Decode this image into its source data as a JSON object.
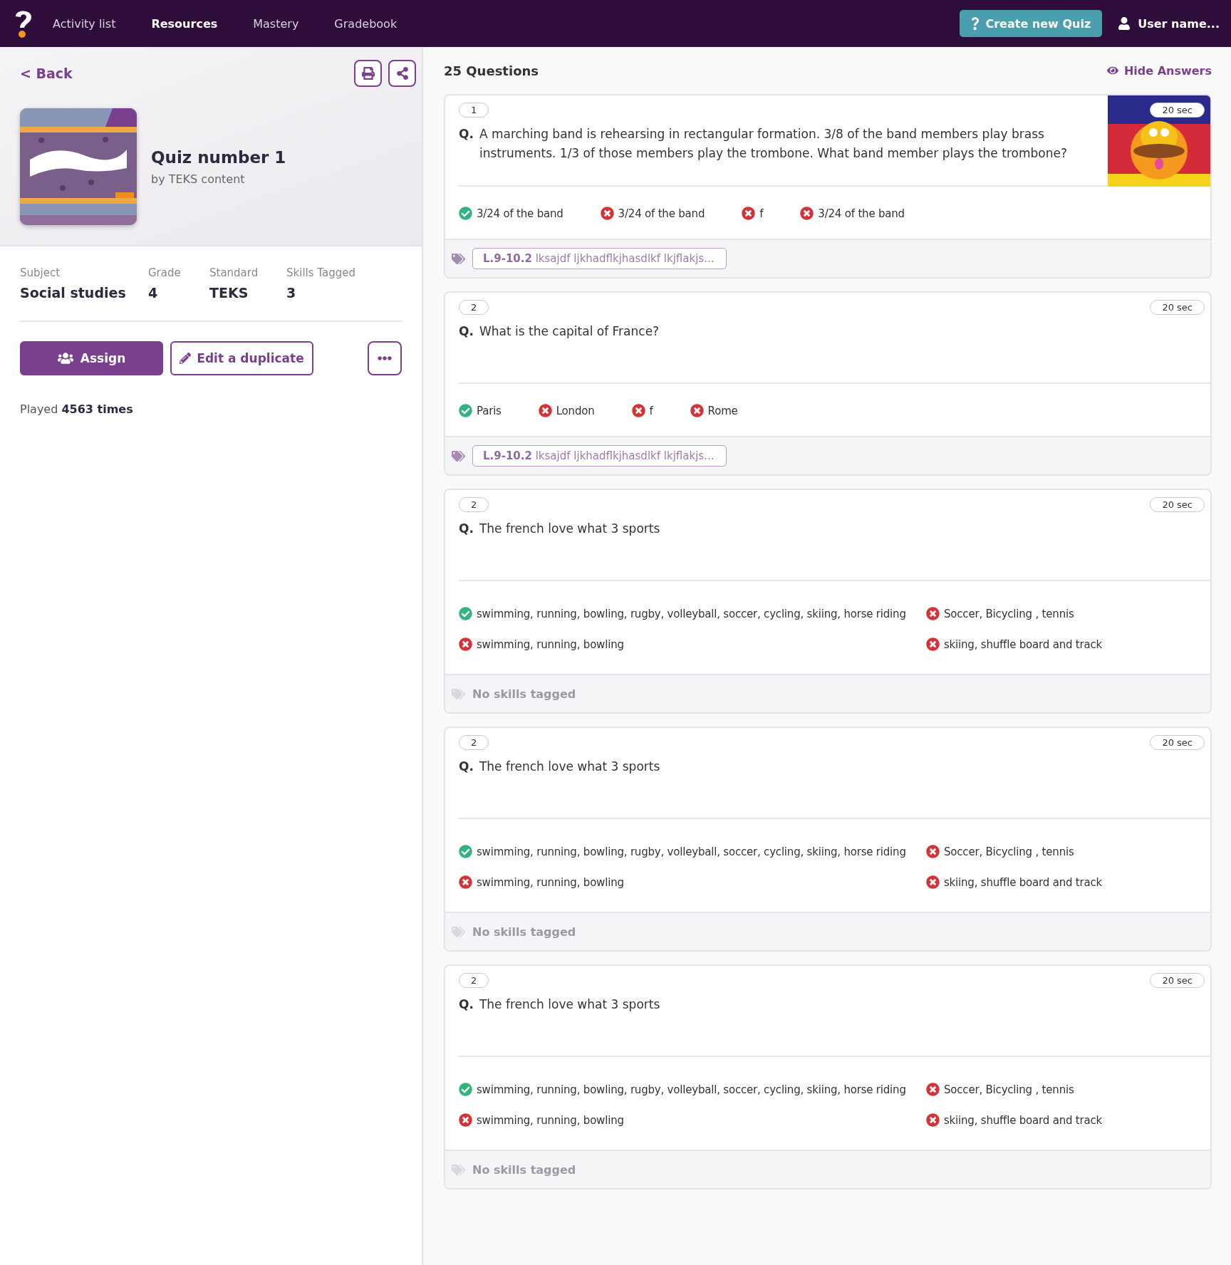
{
  "nav": {
    "items": [
      {
        "label": "Activity list",
        "selected": false
      },
      {
        "label": "Resources",
        "selected": true
      },
      {
        "label": "Mastery",
        "selected": false
      },
      {
        "label": "Gradebook",
        "selected": false
      }
    ],
    "create_button": "Create new Quiz",
    "user": "User name..."
  },
  "sidebar": {
    "back": "< Back",
    "quiz": {
      "title": "Quiz number 1",
      "author": "by TEKS content"
    },
    "stats": [
      {
        "label": "Subject",
        "value": "Social studies"
      },
      {
        "label": "Grade",
        "value": "4"
      },
      {
        "label": "Standard",
        "value": "TEKS"
      },
      {
        "label": "Skills Tagged",
        "value": "3"
      }
    ],
    "assign_button": "Assign",
    "duplicate_button": "Edit a duplicate",
    "played": "Played **4563 times**"
  },
  "questions_header": {
    "count": "25 Questions",
    "hide_answers": "Hide Answers"
  },
  "questions": [
    {
      "kind": "row",
      "number": "1",
      "time": "20 sec",
      "image": {
        "kind": "picture"
      },
      "prefix": "Q.",
      "text": "A marching band is rehearsing in rectangular formation. 3/8 of the band members play brass instruments. 1/3 of those members play the trombone. What band member plays the trombone?",
      "answers": [
        {
          "text": "3/24 of the band",
          "correct": true
        },
        {
          "text": "3/24 of the band",
          "correct": false
        },
        {
          "text": "f",
          "correct": false
        },
        {
          "text": "3/24 of the band",
          "correct": false
        }
      ],
      "tags": [
        "**L.9-10.2** lksajdf ljkhadflkjhasdlkf lkjflakjs..."
      ]
    },
    {
      "kind": "row",
      "number": "2",
      "time": "20 sec",
      "prefix": "Q.",
      "text": "What is the capital of France?",
      "answers": [
        {
          "text": "Paris",
          "correct": true
        },
        {
          "text": "London",
          "correct": false
        },
        {
          "text": "f",
          "correct": false
        },
        {
          "text": "Rome",
          "correct": false
        }
      ],
      "tags": [
        "**L.9-10.2** lksajdf ljkhadflkjhasdlkf lkjflakjs..."
      ]
    },
    {
      "kind": "grid",
      "number": "2",
      "time": "20 sec",
      "prefix": "Q.",
      "text": "The french love what 3 sports",
      "answers": [
        {
          "text": "swimming, running, bowling, rugby, volleyball, soccer, cycling, skiing, horse riding",
          "correct": true
        },
        {
          "text": "Soccer, Bicycling , tennis",
          "correct": false
        },
        {
          "text": "swimming, running, bowling",
          "correct": false
        },
        {
          "text": "skiing, shuffle board and track",
          "correct": false
        }
      ],
      "no_tags": "No skills tagged"
    },
    {
      "kind": "grid",
      "number": "2",
      "time": "20 sec",
      "prefix": "Q.",
      "text": "The french love what 3 sports",
      "answers": [
        {
          "text": "swimming, running, bowling, rugby, volleyball, soccer, cycling, skiing, horse riding",
          "correct": true
        },
        {
          "text": "Soccer, Bicycling , tennis",
          "correct": false
        },
        {
          "text": "swimming, running, bowling",
          "correct": false
        },
        {
          "text": "skiing, shuffle board and track",
          "correct": false
        }
      ],
      "no_tags": "No skills tagged"
    },
    {
      "kind": "grid",
      "number": "2",
      "time": "20 sec",
      "prefix": "Q.",
      "text": "The french love what 3 sports",
      "answers": [
        {
          "text": "swimming, running, bowling, rugby, volleyball, soccer, cycling, skiing, horse riding",
          "correct": true
        },
        {
          "text": "Soccer, Bicycling , tennis",
          "correct": false
        },
        {
          "text": "swimming, running, bowling",
          "correct": false
        },
        {
          "text": "skiing, shuffle board and track",
          "correct": false
        }
      ],
      "no_tags": "No skills tagged"
    }
  ]
}
